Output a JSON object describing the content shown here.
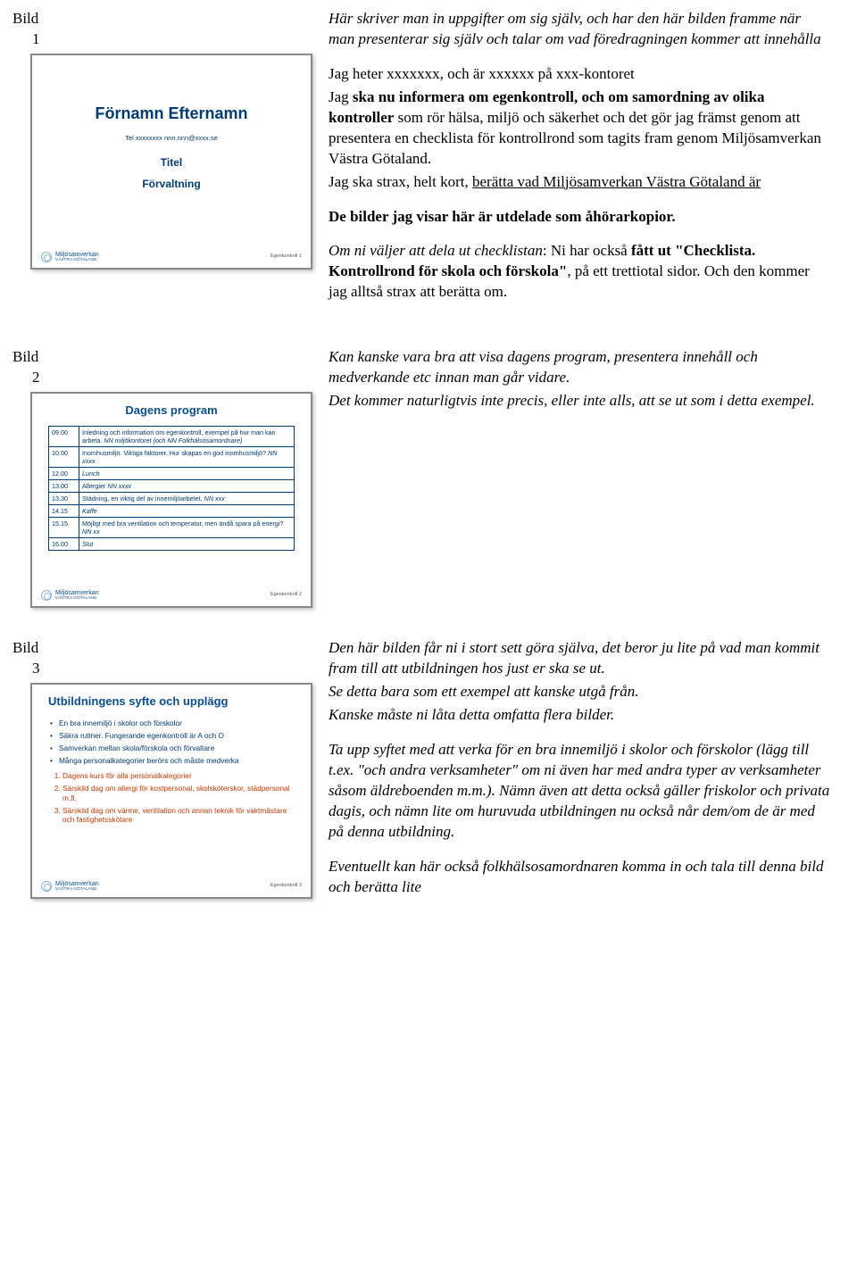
{
  "bild_label": "Bild",
  "logo_main": "Miljösamverkan",
  "logo_sub": "VÄSTRA GÖTALAND",
  "slide1": {
    "num": "1",
    "title": "Förnamn Efternamn",
    "tel": "Tel  xxxxxxxx  nnn.nnn@xxxx.se",
    "sub1": "Titel",
    "sub2": "Förvaltning",
    "footer_num": "Egenkontroll 1"
  },
  "right1": {
    "p1": "Här skriver man in uppgifter om sig själv, och har den här bilden framme när man presenterar sig själv och talar om vad föredragningen kommer att innehålla",
    "p2a": "Jag heter xxxxxxx, och är   xxxxxx på xxx-kontoret",
    "p2b_pre": "Jag  ",
    "p2b_bold": "ska nu informera om egenkontroll, och om samordning av olika kontroller",
    "p2b_post": " som rör hälsa, miljö och säkerhet och det gör jag främst genom att presentera en checklista för kontrollrond som tagits fram genom Miljösamverkan Västra Götaland.",
    "p2c_pre": "Jag ska strax, helt kort, ",
    "p2c_under": "berätta vad Miljösamverkan Västra Götaland är",
    "p3": "De bilder jag visar här är utdelade som åhörarkopior.",
    "p4_it": "Om ni väljer att dela ut checklistan",
    "p4_a": ": Ni har också ",
    "p4_b": "fått ut \"Checklista. Kontrollrond för skola och förskola\"",
    "p4_c": ", på ett trettiotal sidor. Och den kommer jag alltså strax att berätta om."
  },
  "slide2": {
    "num": "2",
    "title": "Dagens program",
    "footer_num": "Egenkontroll 2",
    "rows": [
      {
        "t": "09.00",
        "d": "Inledning och information om egenkontroll, exempel på hur man kan arbeta. <span class='it'>NN miljökontoret (och NN Folkhälsosamordnare)</span>"
      },
      {
        "t": "10.00",
        "d": "Inomhusmiljö. Viktiga faktorer. Hur skapas en god inomhusmiljö? <span class='it'>NN xxxx</span>"
      },
      {
        "t": "12.00",
        "d": "<span class='it'>Lunch</span>"
      },
      {
        "t": "13.00",
        "d": "Allergier <span class='it'>NN xxxx</span>"
      },
      {
        "t": "13.30",
        "d": "Städning, en viktig del av innemiljöarbetet. <span class='it'>NN xxx</span>"
      },
      {
        "t": "14.15",
        "d": "<span class='it'>Kaffe</span>"
      },
      {
        "t": "15.15",
        "d": "Möjligt med bra ventilation och temperatur, men ändå spara på energi? <span class='it'>NN xx</span>"
      },
      {
        "t": "16.00",
        "d": "<span class='it'>Slut</span>"
      }
    ]
  },
  "right2": {
    "p1": "Kan kanske vara bra att visa dagens program, presentera innehåll och medverkande etc innan man går vidare.",
    "p2": "Det kommer naturligtvis inte precis, eller inte alls, att se ut som i detta exempel."
  },
  "slide3": {
    "num": "3",
    "title": "Utbildningens syfte och upplägg",
    "footer_num": "Egenkontroll 3",
    "bullets": [
      "En bra innemiljö i skolor och förskolor",
      "Säkra rutiner. Fungerande egenkontroll är A och O",
      "Samverkan mellan skola/förskola och förvaltare",
      "Många personalkategorier berörs och måste medverka"
    ],
    "num_list": [
      "Dagens kurs för alla personalkategorier",
      "Särskild dag om allergi för kostpersonal, skolsköterskor, städpersonal m.fl.",
      "Särskild dag om värme, ventilation och annan teknik för vaktmästare och fastighetsskötare"
    ]
  },
  "right3": {
    "p1a": "Den här bilden får ni i stort sett göra själva, det beror ju lite på vad man kommit fram till att utbildningen hos just er ska se ut.",
    "p1b": "Se detta bara som ett exempel att kanske utgå från.",
    "p1c": "Kanske måste ni låta detta omfatta flera bilder.",
    "p2a": "Ta upp syftet med att verka för en bra innemiljö i skolor och förskolor  (lägg till t.ex.  \"och andra verksamheter\" om ni även har med andra typer av verksamheter såsom äldreboenden m.m.). Nämn även att detta också gäller friskolor och privata dagis, och nämn lite om huruvuda utbildningen nu också når dem/om de är med på denna utbildning.",
    "p3": "Eventuellt kan här också folkhälsosamordnaren komma in och tala till denna bild och berätta lite"
  }
}
